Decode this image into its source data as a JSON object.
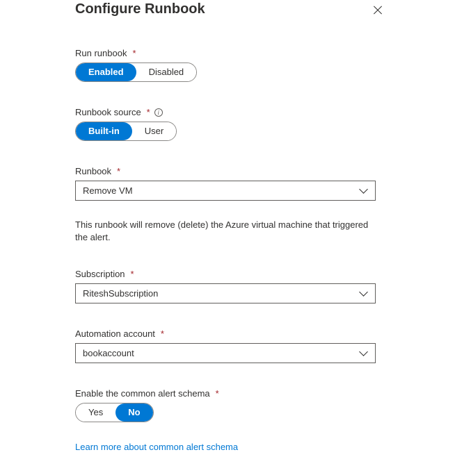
{
  "header": {
    "title": "Configure Runbook"
  },
  "fields": {
    "runRunbook": {
      "label": "Run runbook",
      "opt1": "Enabled",
      "opt2": "Disabled"
    },
    "runbookSource": {
      "label": "Runbook source",
      "opt1": "Built-in",
      "opt2": "User"
    },
    "runbook": {
      "label": "Runbook",
      "value": "Remove VM",
      "description": "This runbook will remove (delete) the Azure virtual machine that triggered the alert."
    },
    "subscription": {
      "label": "Subscription",
      "value": "RiteshSubscription"
    },
    "automationAccount": {
      "label": "Automation account",
      "value": "bookaccount"
    },
    "commonAlert": {
      "label": "Enable the common alert schema",
      "opt1": "Yes",
      "opt2": "No"
    }
  },
  "link": {
    "text": "Learn more about common alert schema"
  }
}
